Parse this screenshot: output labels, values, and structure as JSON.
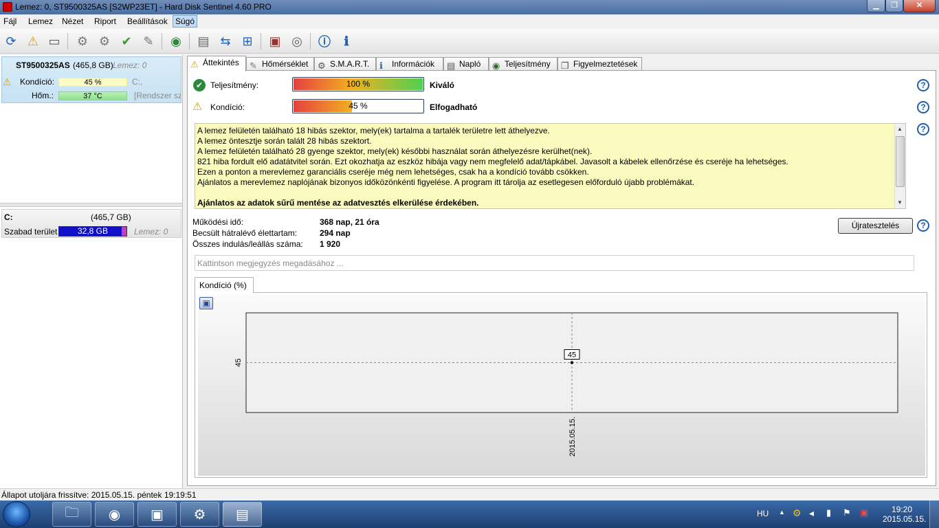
{
  "window": {
    "title": "Lemez: 0, ST9500325AS [S2WP23ET]  -  Hard Disk Sentinel 4.60 PRO"
  },
  "menu": [
    "Fájl",
    "Lemez",
    "Nézet",
    "Riport",
    "Beállítások",
    "Súgó"
  ],
  "left": {
    "disk": {
      "model": "ST9500325AS",
      "size": "(465,8 GB)",
      "index": "Lemez: 0",
      "condition_label": "Kondíció:",
      "condition_value": "45 %",
      "condition_fraction": 0.45,
      "drive": "C:,",
      "temp_label": "Hőm.:",
      "temp_value": "37 °C",
      "temp_note": "[Rendszer szá"
    },
    "volume": {
      "letter": "C:",
      "size": "(465,7 GB)",
      "free_label": "Szabad terület",
      "free_value": "32,8 GB",
      "free_fraction": 0.93,
      "disk_ref": "Lemez: 0"
    }
  },
  "tabs": [
    "Áttekintés",
    "Hőmérséklet",
    "S.M.A.R.T.",
    "Információk",
    "Napló",
    "Teljesítmény",
    "Figyelmeztetések"
  ],
  "overview": {
    "performance_label": "Teljesítmény:",
    "performance_value": "100 %",
    "performance_fraction": 1.0,
    "performance_rating": "Kiváló",
    "condition_label": "Kondíció:",
    "condition_value": "45 %",
    "condition_fraction": 0.45,
    "condition_rating": "Elfogadható",
    "messages": [
      "A lemez felületén található 18 hibás szektor, mely(ek) tartalma a tartalék területre lett áthelyezve.",
      "A lemez öntesztje során talált 28 hibás szektort.",
      "A lemez felületén található 28 gyenge szektor, mely(ek) későbbi használat során áthelyezésre kerülhet(nek).",
      "821 hiba fordult elő adatátvitel során. Ezt okozhatja az eszköz hibája vagy nem megfelelő adat/tápkábel. Javasolt a kábelek ellenőrzése és cseréje ha lehetséges.",
      "Ezen a ponton a merevlemez garanciális cseréje még nem lehetséges, csak ha a kondíció tovább csökken.",
      "Ajánlatos a merevlemez naplójának bizonyos időközönkénti figyelése. A program itt tárolja az esetlegesen előforduló újabb problémákat."
    ],
    "warning": "Ajánlatos az adatok sűrű mentése az adatvesztés elkerülése érdekében.",
    "stats": {
      "uptime_label": "Működési idő:",
      "uptime_value": "368 nap, 21 óra",
      "remaining_label": "Becsült hátralévő élettartam:",
      "remaining_value": "294 nap",
      "starts_label": "Összes indulás/leállás száma:",
      "starts_value": "1 920"
    },
    "retest_button": "Újratesztelés",
    "note_placeholder": "Kattintson megjegyzés megadásához ...",
    "chart_tab": "Kondíció  (%)"
  },
  "chart_data": {
    "type": "line",
    "x": [
      "2015.05.15."
    ],
    "series": [
      {
        "values": [
          45
        ]
      }
    ],
    "point_labels": [
      "45"
    ],
    "ytick_labels": [
      "45"
    ],
    "xtick_labels": [
      "2015.05.15."
    ],
    "grid": true
  },
  "status": "Állapot utoljára frissítve: 2015.05.15. péntek 19:19:51",
  "taskbar": {
    "lang": "HU",
    "time": "19:20",
    "date": "2015.05.15."
  }
}
